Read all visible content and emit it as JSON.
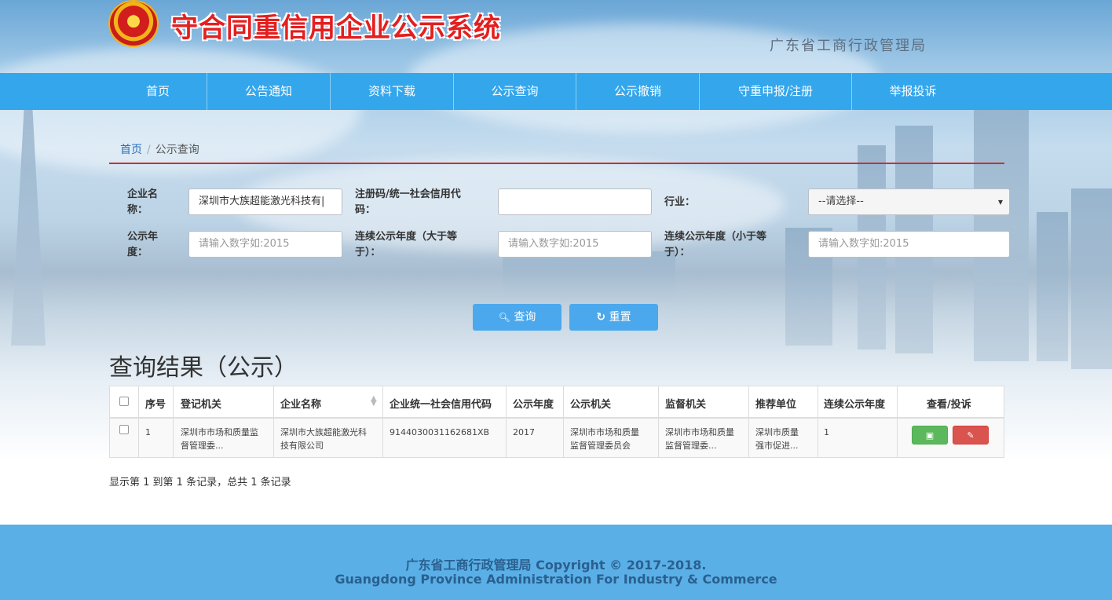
{
  "header": {
    "title": "守合同重信用企业公示系统",
    "subtitle": "广东省工商行政管理局"
  },
  "nav": {
    "items": [
      {
        "label": "首页"
      },
      {
        "label": "公告通知"
      },
      {
        "label": "资料下载"
      },
      {
        "label": "公示查询"
      },
      {
        "label": "公示撤销"
      },
      {
        "label": "守重申报/注册"
      },
      {
        "label": "举报投诉"
      }
    ]
  },
  "breadcrumb": {
    "home": "首页",
    "separator": "/",
    "current": "公示查询"
  },
  "form": {
    "company_name_label_1": "企业名",
    "company_name_label_2": "称：",
    "company_name_value": "深圳市大族超能激光科技有|",
    "reg_code_label_1": "注册码/统一社会信用代",
    "reg_code_label_2": "码：",
    "reg_code_value": "",
    "industry_label": "行业：",
    "industry_selected": "--请选择--",
    "year_label_1": "公示年",
    "year_label_2": "度：",
    "year_placeholder": "请输入数字如:2015",
    "cont_gt_label_1": "连续公示年度（大于等",
    "cont_gt_label_2": "于）：",
    "cont_gt_placeholder": "请输入数字如:2015",
    "cont_lt_label_1": "连续公示年度（小于等",
    "cont_lt_label_2": "于）：",
    "cont_lt_placeholder": "请输入数字如:2015",
    "search_label": "查询",
    "reset_label": "重置"
  },
  "results": {
    "title": "查询结果（公示）",
    "columns": [
      "序号",
      "登记机关",
      "企业名称",
      "企业统一社会信用代码",
      "公示年度",
      "公示机关",
      "监督机关",
      "推荐单位",
      "连续公示年度",
      "查看/投诉"
    ],
    "rows": [
      {
        "no": "1",
        "reg_org_1": "深圳市市场和质量监",
        "reg_org_2": "督管理委...",
        "company_1": "深圳市大族超能激光科",
        "company_2": "技有限公司",
        "credit_code": "914403003116268​1XB",
        "year": "2017",
        "pub_org_1": "深圳市市场和质量",
        "pub_org_2": "监督管理委员会",
        "sup_org_1": "深圳市市场和质量",
        "sup_org_2": "监督管理委...",
        "recommend_1": "深圳市质量",
        "recommend_2": "强市促进...",
        "cont_years": "1"
      }
    ],
    "summary": "显示第 1 到第 1 条记录，总共 1 条记录"
  },
  "footer": {
    "line1": "广东省工商行政管理局 Copyright © 2017-2018.",
    "line2": "Guangdong Province Administration For Industry & Commerce"
  },
  "colors": {
    "nav": "#33a6ec",
    "title_red": "#e41f1f",
    "button_blue": "#4ba8ec",
    "footer": "#5ab0e6",
    "view_green": "#5cb85c",
    "complain_red": "#d9534f"
  }
}
